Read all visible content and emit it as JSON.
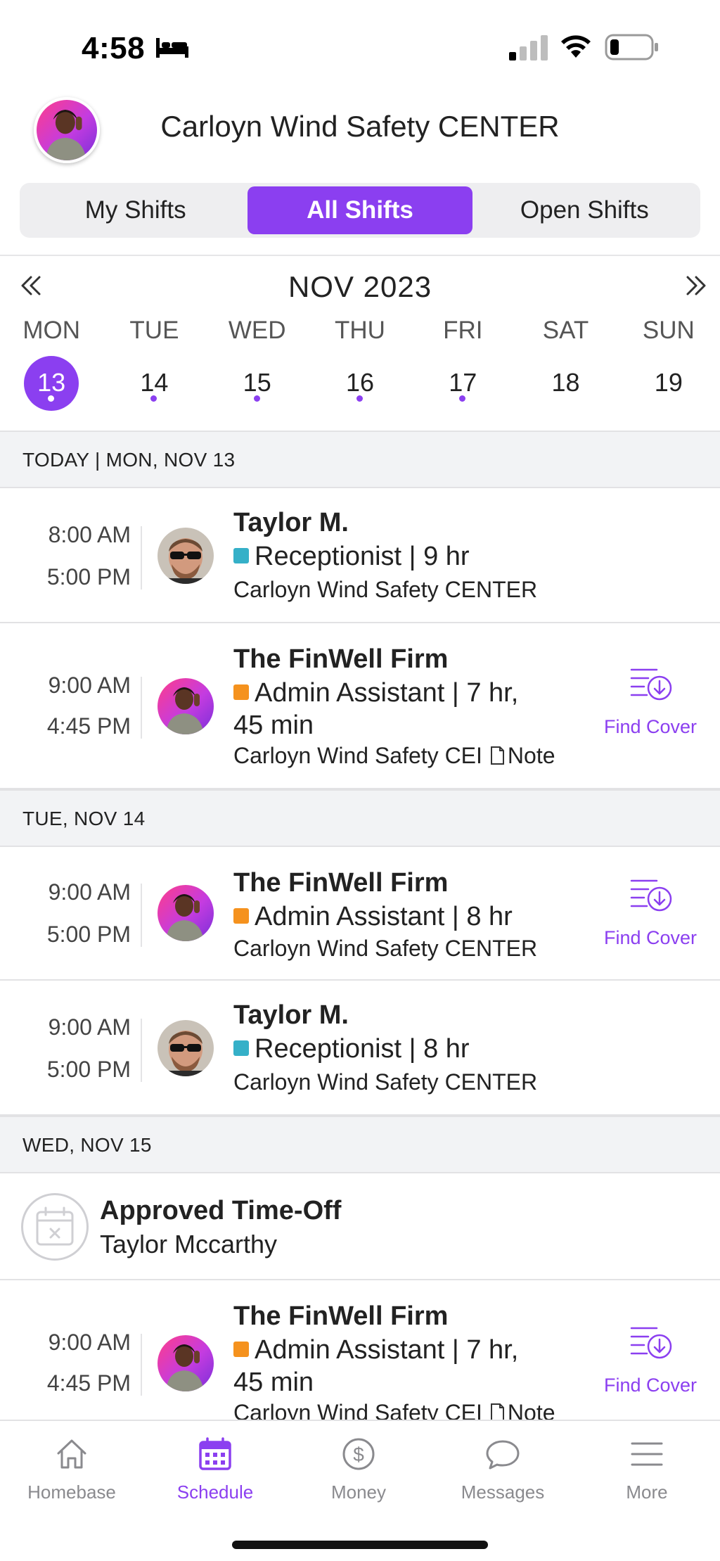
{
  "status_bar": {
    "time": "4:58"
  },
  "header": {
    "title": "Carloyn Wind Safety CENTER"
  },
  "tabs": [
    {
      "label": "My Shifts",
      "active": false
    },
    {
      "label": "All Shifts",
      "active": true
    },
    {
      "label": "Open Shifts",
      "active": false
    }
  ],
  "calendar": {
    "month": "NOV 2023",
    "weekdays": [
      "MON",
      "TUE",
      "WED",
      "THU",
      "FRI",
      "SAT",
      "SUN"
    ],
    "days": [
      {
        "num": "13",
        "selected": true,
        "has_shifts": true
      },
      {
        "num": "14",
        "selected": false,
        "has_shifts": true
      },
      {
        "num": "15",
        "selected": false,
        "has_shifts": true
      },
      {
        "num": "16",
        "selected": false,
        "has_shifts": true
      },
      {
        "num": "17",
        "selected": false,
        "has_shifts": true
      },
      {
        "num": "18",
        "selected": false,
        "has_shifts": false
      },
      {
        "num": "19",
        "selected": false,
        "has_shifts": false
      }
    ]
  },
  "sections": [
    {
      "label": "TODAY | MON, NOV 13"
    },
    {
      "label": "TUE, NOV 14"
    },
    {
      "label": "WED, NOV 15"
    }
  ],
  "shifts": [
    {
      "start": "8:00 AM",
      "end": "5:00 PM",
      "name": "Taylor M.",
      "role": "Receptionist | 9 hr",
      "location": "Carloyn Wind Safety CENTER",
      "role_color": "#35b0c8"
    },
    {
      "start": "9:00 AM",
      "end": "4:45 PM",
      "name": "The FinWell Firm",
      "role_line1": "Admin Assistant | 7 hr,",
      "role_line2": "45 min",
      "location": "Carloyn Wind Safety CEI",
      "note": "Note",
      "role_color": "#f5921e",
      "action": "Find Cover"
    },
    {
      "start": "9:00 AM",
      "end": "5:00 PM",
      "name": "The FinWell Firm",
      "role": "Admin Assistant | 8 hr",
      "location": "Carloyn Wind Safety CENTER",
      "role_color": "#f5921e",
      "action": "Find Cover"
    },
    {
      "start": "9:00 AM",
      "end": "5:00 PM",
      "name": "Taylor M.",
      "role": "Receptionist | 8 hr",
      "location": "Carloyn Wind Safety CENTER",
      "role_color": "#35b0c8"
    },
    {
      "start": "9:00 AM",
      "end": "4:45 PM",
      "name": "The FinWell Firm",
      "role_line1": "Admin Assistant | 7 hr,",
      "role_line2": "45 min",
      "location": "Carloyn Wind Safety CEI",
      "note": "Note",
      "role_color": "#f5921e",
      "action": "Find Cover"
    }
  ],
  "time_off": {
    "title": "Approved Time-Off",
    "name": "Taylor Mccarthy"
  },
  "bottom_nav": [
    {
      "label": "Homebase",
      "icon": "home-icon",
      "active": false
    },
    {
      "label": "Schedule",
      "icon": "calendar-icon",
      "active": true
    },
    {
      "label": "Money",
      "icon": "dollar-icon",
      "active": false
    },
    {
      "label": "Messages",
      "icon": "chat-bubble-icon",
      "active": false
    },
    {
      "label": "More",
      "icon": "hamburger-menu-icon",
      "active": false
    }
  ],
  "colors": {
    "accent": "#8b3ff0",
    "receptionist": "#35b0c8",
    "admin_assistant": "#f5921e"
  }
}
